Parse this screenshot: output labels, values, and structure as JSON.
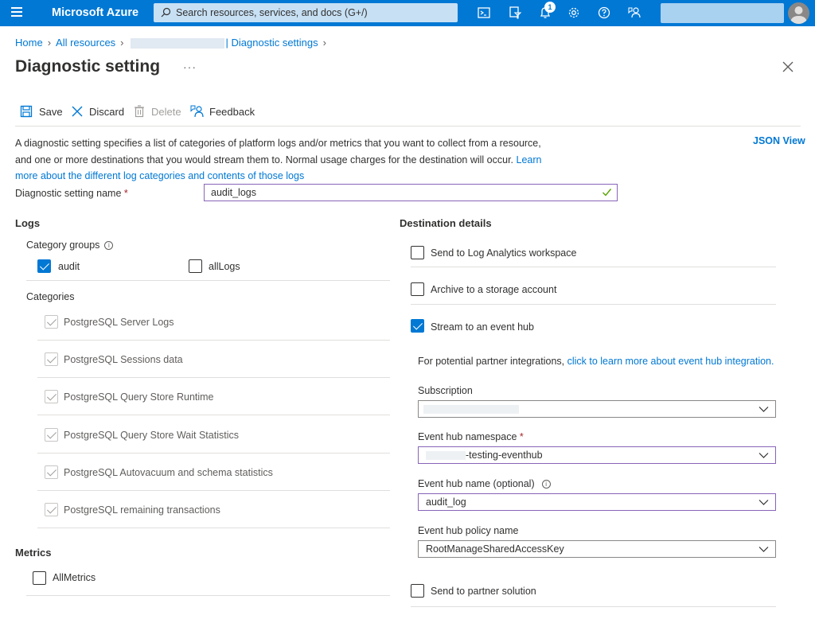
{
  "topbar": {
    "brand": "Microsoft Azure",
    "search_placeholder": "Search resources, services, and docs (G+/)",
    "notification_count": "1"
  },
  "breadcrumb": {
    "home": "Home",
    "all_resources": "All resources",
    "current": "| Diagnostic settings"
  },
  "page_title": "Diagnostic setting",
  "toolbar": {
    "save": "Save",
    "discard": "Discard",
    "delete": "Delete",
    "feedback": "Feedback"
  },
  "description": {
    "text": "A diagnostic setting specifies a list of categories of platform logs and/or metrics that you want to collect from a resource, and one or more destinations that you would stream them to. Normal usage charges for the destination will occur. ",
    "link": "Learn more about the different log categories and contents of those logs"
  },
  "json_view": "JSON View",
  "setting_name": {
    "label": "Diagnostic setting name",
    "required": "*",
    "value": "audit_logs"
  },
  "logs": {
    "heading": "Logs",
    "category_groups_label": "Category groups",
    "groups": [
      {
        "label": "audit",
        "checked": true
      },
      {
        "label": "allLogs",
        "checked": false
      }
    ],
    "categories_label": "Categories",
    "categories": [
      "PostgreSQL Server Logs",
      "PostgreSQL Sessions data",
      "PostgreSQL Query Store Runtime",
      "PostgreSQL Query Store Wait Statistics",
      "PostgreSQL Autovacuum and schema statistics",
      "PostgreSQL remaining transactions"
    ]
  },
  "metrics": {
    "heading": "Metrics",
    "all_metrics": "AllMetrics"
  },
  "destination": {
    "heading": "Destination details",
    "log_analytics": "Send to Log Analytics workspace",
    "storage": "Archive to a storage account",
    "event_hub": "Stream to an event hub",
    "partner_text": "For potential partner integrations, ",
    "partner_link": "click to learn more about event hub integration.",
    "subscription_label": "Subscription",
    "namespace_label": "Event hub namespace",
    "namespace_value": "-testing-eventhub",
    "hub_name_label": "Event hub name (optional)",
    "hub_name_value": "audit_log",
    "policy_label": "Event hub policy name",
    "policy_value": "RootManageSharedAccessKey",
    "partner_solution": "Send to partner solution"
  },
  "colors": {
    "azure_blue": "#0078d4",
    "focus_purple": "#8764b8",
    "required_red": "#a4262c"
  }
}
